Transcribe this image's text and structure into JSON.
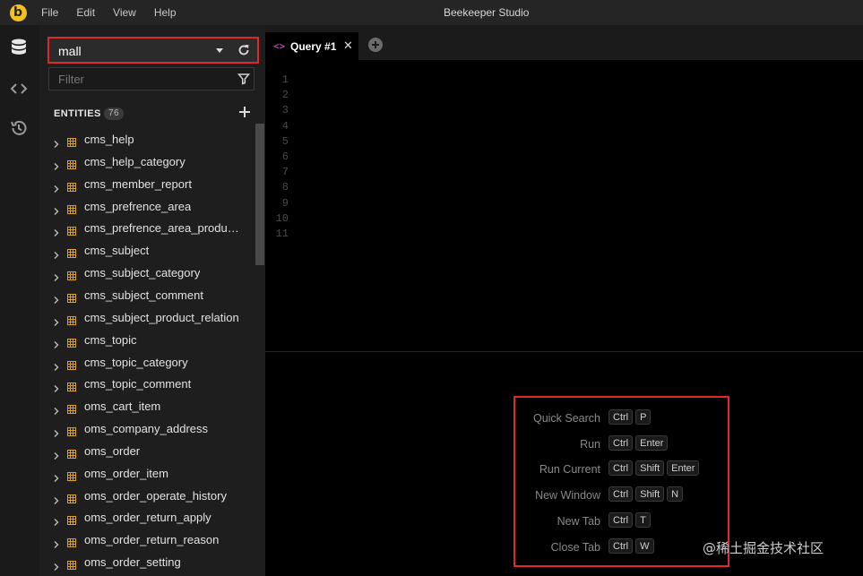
{
  "window": {
    "title": "Beekeeper Studio"
  },
  "menu": [
    "File",
    "Edit",
    "View",
    "Help"
  ],
  "activity_bar": {
    "items": [
      {
        "icon": "database-icon"
      },
      {
        "icon": "code-icon"
      },
      {
        "icon": "history-icon"
      }
    ]
  },
  "sidebar": {
    "connection": "mall",
    "filter_placeholder": "Filter",
    "entities_label": "ENTITIES",
    "entities_count": "76",
    "entities": [
      "cms_help",
      "cms_help_category",
      "cms_member_report",
      "cms_prefrence_area",
      "cms_prefrence_area_product_relation",
      "cms_subject",
      "cms_subject_category",
      "cms_subject_comment",
      "cms_subject_product_relation",
      "cms_topic",
      "cms_topic_category",
      "cms_topic_comment",
      "oms_cart_item",
      "oms_company_address",
      "oms_order",
      "oms_order_item",
      "oms_order_operate_history",
      "oms_order_return_apply",
      "oms_order_return_reason",
      "oms_order_setting"
    ]
  },
  "tabs": [
    {
      "label": "Query #1",
      "icon": "code-icon"
    }
  ],
  "editor": {
    "line_numbers": [
      "1",
      "2",
      "3",
      "4",
      "5",
      "6",
      "7",
      "8",
      "9",
      "10",
      "11"
    ]
  },
  "shortcuts": [
    {
      "label": "Quick Search",
      "keys": [
        "Ctrl",
        "P"
      ]
    },
    {
      "label": "Run",
      "keys": [
        "Ctrl",
        "Enter"
      ]
    },
    {
      "label": "Run Current",
      "keys": [
        "Ctrl",
        "Shift",
        "Enter"
      ]
    },
    {
      "label": "New Window",
      "keys": [
        "Ctrl",
        "Shift",
        "N"
      ]
    },
    {
      "label": "New Tab",
      "keys": [
        "Ctrl",
        "T"
      ]
    },
    {
      "label": "Close Tab",
      "keys": [
        "Ctrl",
        "W"
      ]
    }
  ],
  "watermark": "@稀土掘金技术社区",
  "colors": {
    "accent_yellow": "#f2c01f",
    "table_icon": "#d9a326",
    "highlight_red": "#e3262b",
    "tab_icon": "#d15ad1"
  }
}
